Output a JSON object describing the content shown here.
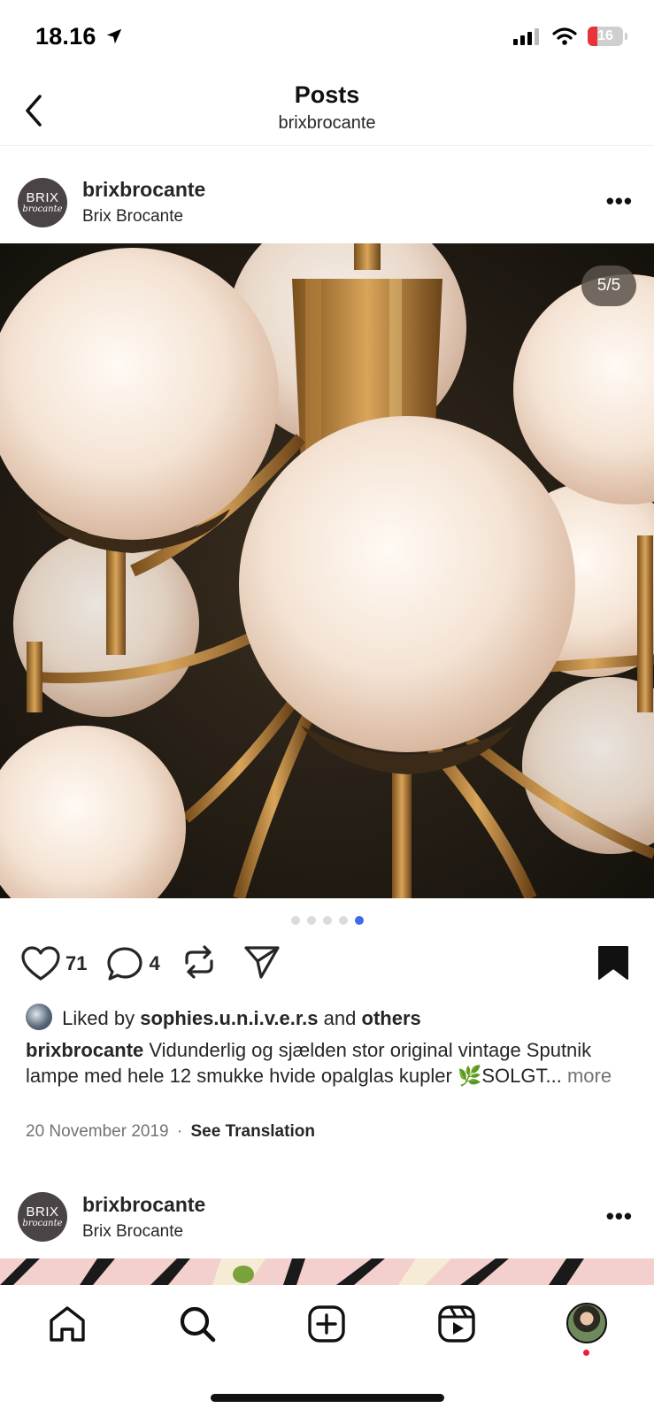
{
  "status_bar": {
    "time": "18.16",
    "battery": "16"
  },
  "header": {
    "title": "Posts",
    "subtitle": "brixbrocante"
  },
  "post": {
    "avatar_text_1": "BRIX",
    "avatar_text_2": "brocante",
    "username": "brixbrocante",
    "full_name": "Brix Brocante",
    "more": "•••",
    "carousel_indicator": "5/5",
    "carousel": {
      "count": 5,
      "active_index": 4
    },
    "likes": "71",
    "comments": "4",
    "liked_by_prefix": "Liked by",
    "liked_by_user": "sophies.u.n.i.v.e.r.s",
    "liked_by_and": "and",
    "liked_by_others": "others",
    "caption_user": "brixbrocante",
    "caption_text": "Vidunderlig og sjælden stor original vintage Sputnik lampe med hele 12 smukke hvide opalglas kupler 🌿SOLGT...",
    "more_label": "more",
    "date": "20 November 2019",
    "separator": "·",
    "see_translation": "See Translation"
  },
  "next_post": {
    "avatar_text_1": "BRIX",
    "avatar_text_2": "brocante",
    "username": "brixbrocante",
    "full_name": "Brix Brocante",
    "more": "•••"
  },
  "tab_bar": {
    "icons": [
      "home-icon",
      "search-icon",
      "create-icon",
      "reels-icon",
      "profile-avatar"
    ]
  },
  "colors": {
    "accent_dot": "#3f6ae8",
    "notification_dot": "#ed1c3a"
  }
}
